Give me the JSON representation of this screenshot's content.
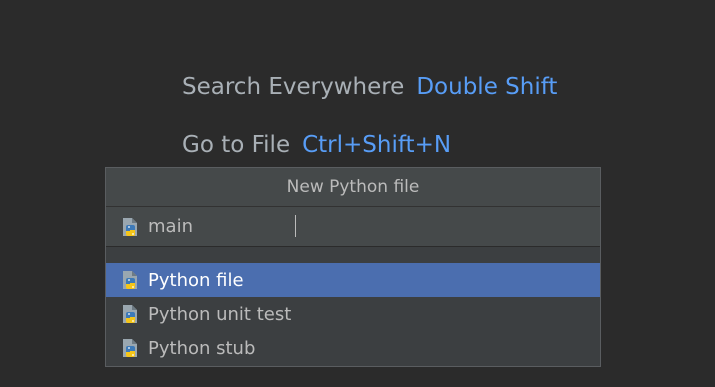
{
  "hints": [
    {
      "label": "Search Everywhere",
      "shortcut": "Double Shift"
    },
    {
      "label": "Go to File",
      "shortcut": "Ctrl+Shift+N"
    }
  ],
  "dialog": {
    "title": "New Python file",
    "name_value": "main",
    "kinds": [
      {
        "label": "Python file",
        "selected": true
      },
      {
        "label": "Python unit test",
        "selected": false
      },
      {
        "label": "Python stub",
        "selected": false
      }
    ],
    "icon": "python-file-icon"
  },
  "colors": {
    "background": "#2b2b2b",
    "popup": "#3c3f41",
    "selection": "#4b6eaf",
    "shortcut": "#589df6",
    "text": "#bbbbbb"
  }
}
